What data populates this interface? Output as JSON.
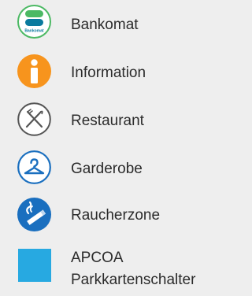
{
  "legend": {
    "items": [
      {
        "label": "Bankomat",
        "icon": "bankomat-icon",
        "icon_text": "Bankomat",
        "color": "#4cb964"
      },
      {
        "label": "Information",
        "icon": "information-icon",
        "color": "#f7941d"
      },
      {
        "label": "Restaurant",
        "icon": "restaurant-icon",
        "color": "#555555"
      },
      {
        "label": "Garderobe",
        "icon": "garderobe-icon",
        "color": "#1a6fbf"
      },
      {
        "label": "Raucherzone",
        "icon": "smoking-area-icon",
        "color": "#1a6fbf"
      },
      {
        "label_line1": "APCOA",
        "label_line2": "Parkkartenschalter",
        "icon": "parking-card-counter-icon",
        "color": "#27a9e1"
      }
    ]
  }
}
